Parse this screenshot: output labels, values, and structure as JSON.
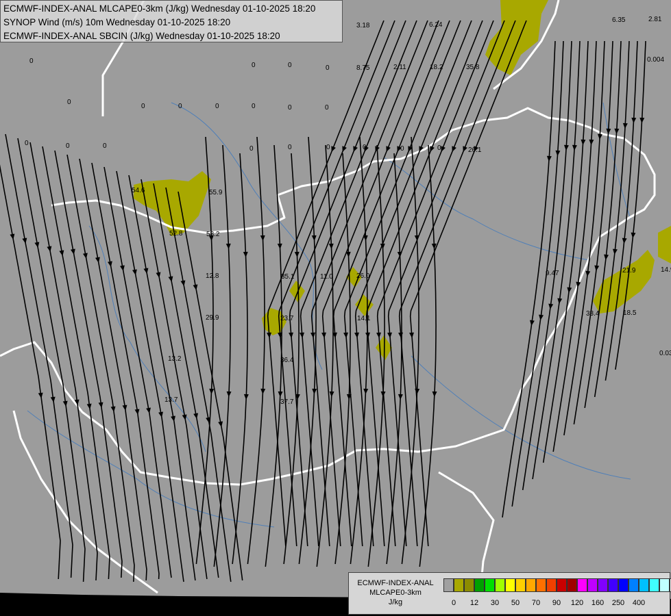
{
  "header_lines": [
    "ECMWF-INDEX-ANAL MLCAPE0-3km (J/kg) Wednesday 01-10-2025 18:20",
    "SYNOP Wind (m/s) 10m Wednesday 01-10-2025 18:20",
    "ECMWF-INDEX-ANAL SBCIN (J/kg) Wednesday 01-10-2025 18:20"
  ],
  "colorbar": {
    "title_lines": [
      "ECMWF-INDEX-ANAL",
      "MLCAPE0-3km",
      "J/kg"
    ],
    "tick_labels": [
      "0",
      "12",
      "30",
      "50",
      "70",
      "90",
      "120",
      "160",
      "250",
      "400"
    ],
    "colors": [
      "#a0a0a0",
      "#a8a800",
      "#8c8c00",
      "#00a000",
      "#00e000",
      "#a0ff00",
      "#ffff00",
      "#ffd000",
      "#ffa800",
      "#ff7000",
      "#f04000",
      "#c80000",
      "#a00000",
      "#ff00ff",
      "#c000ff",
      "#8000ff",
      "#4000ff",
      "#0000ff",
      "#0080ff",
      "#00c0ff",
      "#40ffff",
      "#c0ffff",
      "#ffffff"
    ]
  },
  "colors": {
    "background": "#9c9c9c",
    "cape_low": "#a8a800",
    "border": "#ffffff",
    "rivers": "#4f7fb8",
    "streamlines": "#000000"
  },
  "station_values": [
    "3.18",
    "6.24",
    "6.35",
    "2.81",
    "0.004",
    "8.75",
    "2.11",
    "18.2",
    "35.8",
    "26.1",
    "54.6",
    "55.9",
    "52.8",
    "58.2",
    "12.8",
    "35.1",
    "11.0",
    "26.0",
    "9.47",
    "21.9",
    "14.9",
    "23.7",
    "14.1",
    "33.4",
    "18.5",
    "29.9",
    "13.2",
    "36.4",
    "0.03",
    "13.7",
    "37.7",
    "0",
    "0",
    "0",
    "0",
    "0",
    "0",
    "0",
    "0",
    "0",
    "0",
    "0",
    "0",
    "0",
    "0",
    "0",
    "0",
    "0",
    "0",
    "0",
    "0"
  ]
}
